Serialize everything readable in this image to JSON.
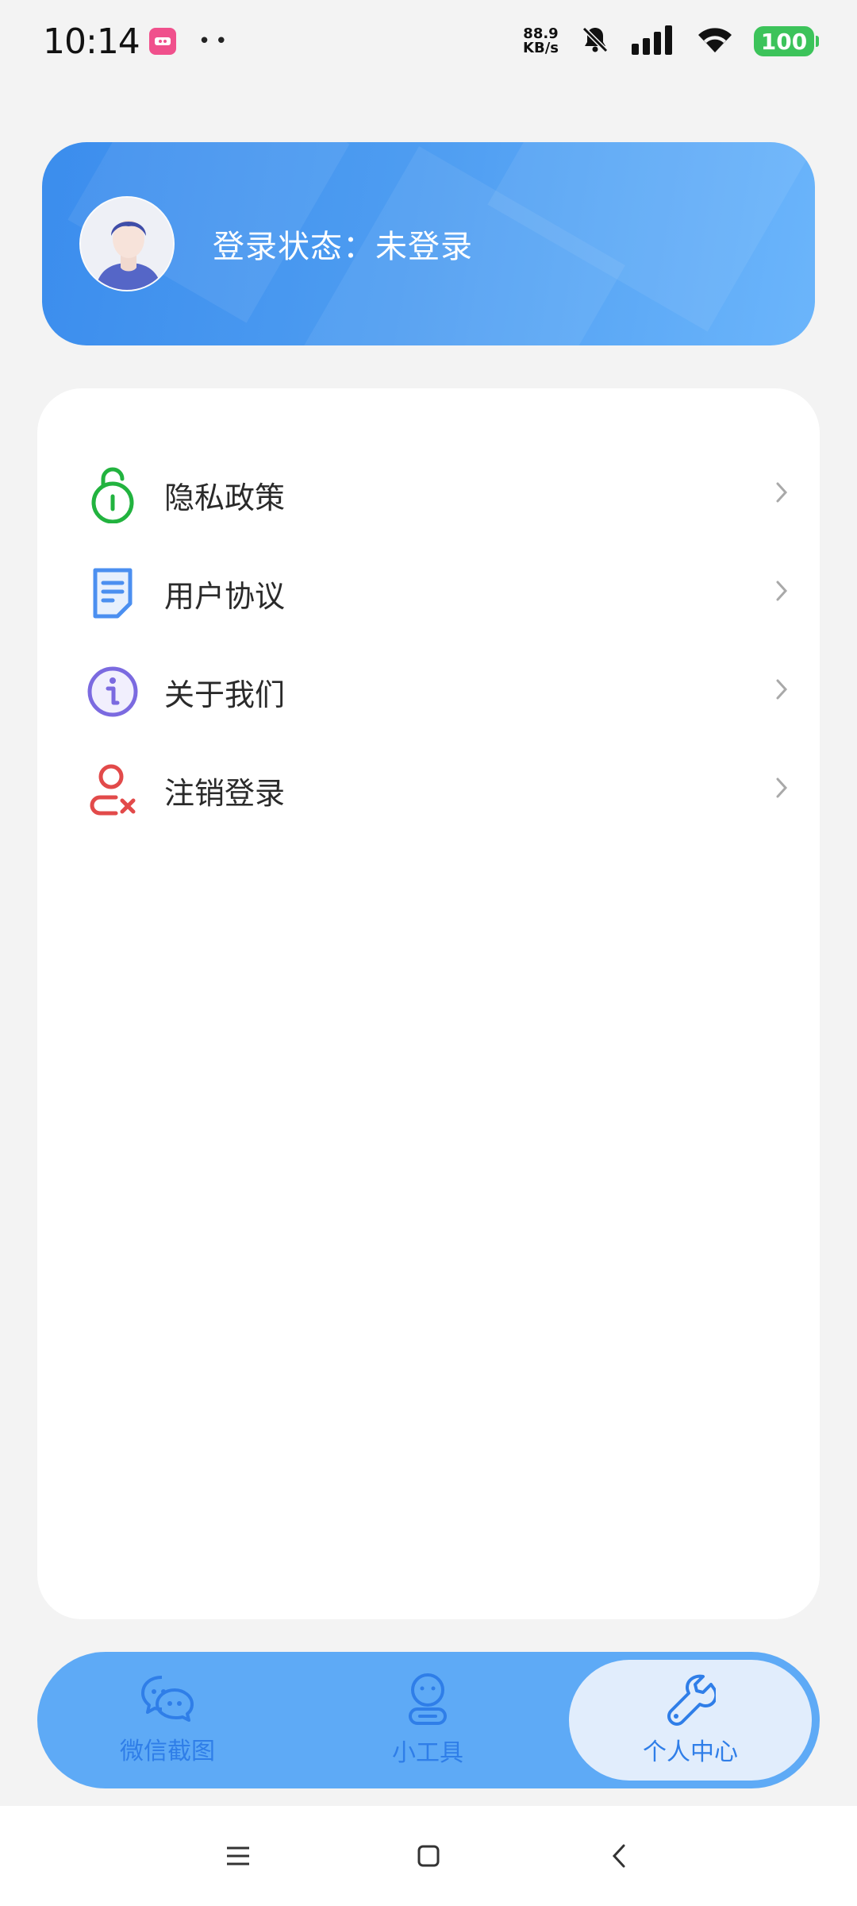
{
  "status_bar": {
    "time": "10:14",
    "net_speed_value": "88.9",
    "net_speed_unit": "KB/s",
    "battery": "100",
    "colors": {
      "battery": "#3cc35a"
    }
  },
  "profile": {
    "login_status": "登录状态：未登录",
    "avatar_icon": "user-avatar"
  },
  "menu": {
    "items": [
      {
        "label": "隐私政策",
        "icon": "unlock-icon",
        "color": "#22b33f"
      },
      {
        "label": "用户协议",
        "icon": "document-icon",
        "color": "#4b8ff0"
      },
      {
        "label": "关于我们",
        "icon": "info-icon",
        "color": "#7b6ae0"
      },
      {
        "label": "注销登录",
        "icon": "user-remove-icon",
        "color": "#e24a4a"
      }
    ]
  },
  "tabs": [
    {
      "label": "微信截图",
      "icon": "chat-bubbles-icon",
      "active": false
    },
    {
      "label": "小工具",
      "icon": "robot-icon",
      "active": false
    },
    {
      "label": "个人中心",
      "icon": "wrench-icon",
      "active": true
    }
  ],
  "colors": {
    "accent": "#2f7ee8",
    "tab_bar": "#5eaaf6",
    "active_tab": "#e1edfc"
  }
}
